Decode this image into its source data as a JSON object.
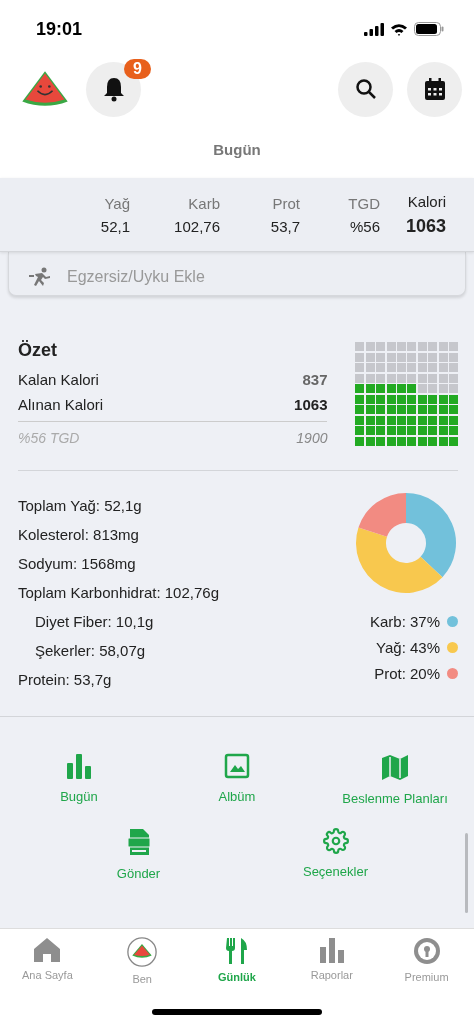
{
  "status_bar": {
    "time": "19:01"
  },
  "header": {
    "notification_count": "9",
    "title": "Bugün"
  },
  "macros": [
    {
      "label": "Yağ",
      "value": "52,1",
      "emphasis": false
    },
    {
      "label": "Karb",
      "value": "102,76",
      "emphasis": false
    },
    {
      "label": "Prot",
      "value": "53,7",
      "emphasis": false
    },
    {
      "label": "TGD",
      "value": "%56",
      "emphasis": false
    },
    {
      "label": "Kalori",
      "value": "1063",
      "emphasis": true
    }
  ],
  "add_card": {
    "label": "Egzersiz/Uyku Ekle"
  },
  "summary": {
    "title": "Özet",
    "rows": [
      {
        "label": "Kalan Kalori",
        "value": "837",
        "emphasis": false
      },
      {
        "label": "Alınan Kalori",
        "value": "1063",
        "emphasis": true
      }
    ],
    "goal_label": "%56 TGD",
    "goal_value": "1900"
  },
  "nutrients": [
    {
      "text": "Toplam Yağ: 52,1g",
      "indented": false
    },
    {
      "text": "Kolesterol: 813mg",
      "indented": false
    },
    {
      "text": "Sodyum: 1568mg",
      "indented": false
    },
    {
      "text": "Toplam Karbonhidrat: 102,76g",
      "indented": false
    },
    {
      "text": "Diyet Fiber: 10,1g",
      "indented": true
    },
    {
      "text": "Şekerler: 58,07g",
      "indented": true
    },
    {
      "text": "Protein: 53,7g",
      "indented": false
    }
  ],
  "macro_chart": {
    "chart_data": {
      "type": "donut",
      "values": [
        37,
        43,
        20
      ],
      "colors": [
        "#72c1db",
        "#f8c84e",
        "#f28b82"
      ]
    },
    "legend": [
      {
        "label": "Karb: 37%",
        "color": "#72c1db"
      },
      {
        "label": "Yağ: 43%",
        "color": "#f8c84e"
      },
      {
        "label": "Prot: 20%",
        "color": "#f28b82"
      }
    ]
  },
  "menu": [
    {
      "label": "Bugün",
      "kind": "bars"
    },
    {
      "label": "Albüm",
      "kind": "image"
    },
    {
      "label": "Beslenme Planları",
      "kind": "map"
    },
    {
      "label": "Gönder",
      "kind": "document"
    },
    {
      "label": "Seçenekler",
      "kind": "gear"
    }
  ],
  "tab_bar": [
    {
      "label": "Ana Sayfa",
      "kind": "home",
      "selected": false
    },
    {
      "label": "Ben",
      "kind": "avatar",
      "selected": false
    },
    {
      "label": "Günlük",
      "kind": "cutlery",
      "selected": true
    },
    {
      "label": "Raporlar",
      "kind": "bars",
      "selected": false
    },
    {
      "label": "Premium",
      "kind": "lock",
      "selected": false
    }
  ]
}
